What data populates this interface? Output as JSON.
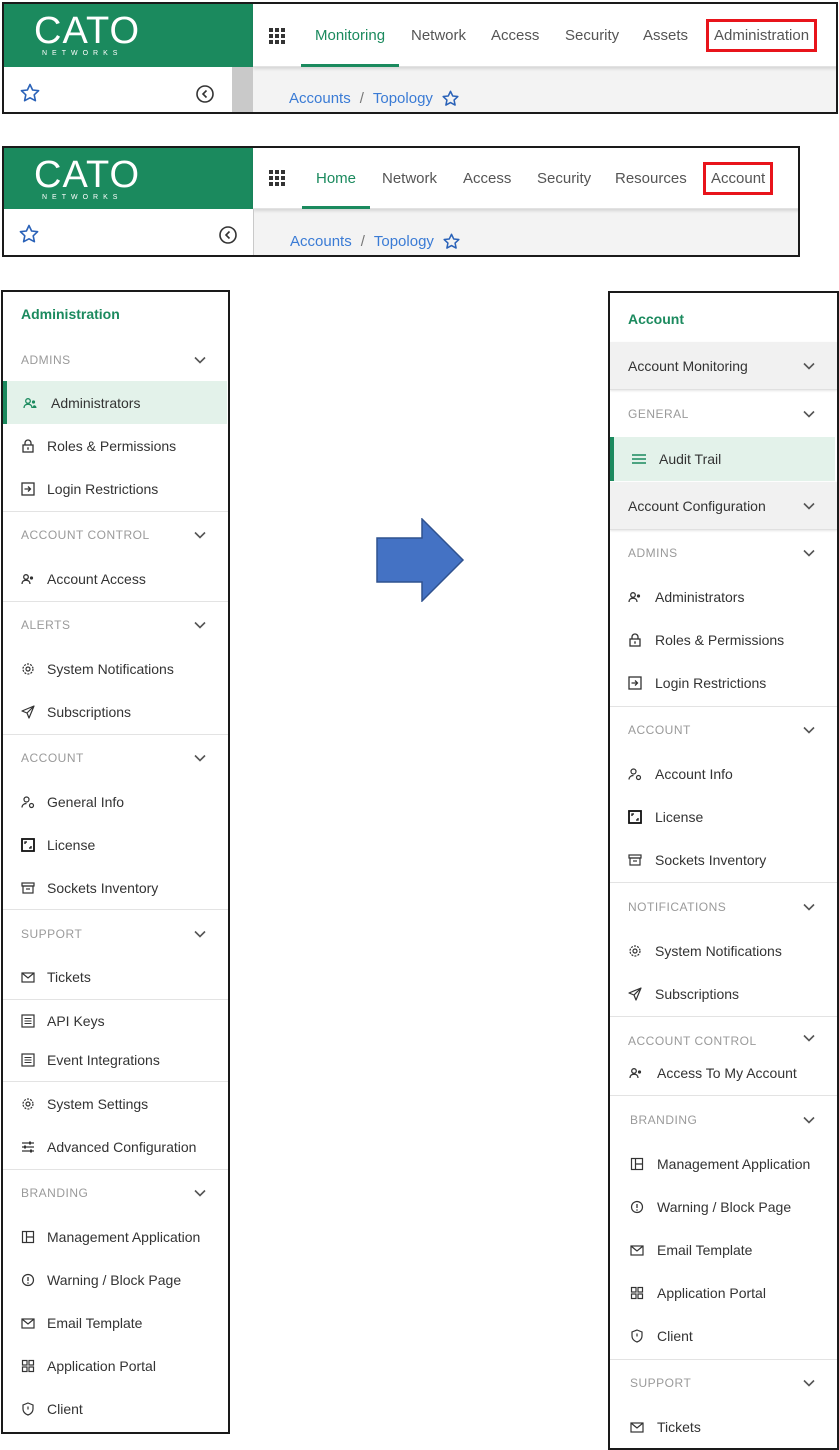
{
  "header_old": {
    "logo": {
      "word": "CATO",
      "sub": "NETWORKS"
    },
    "nav": [
      "Monitoring",
      "Network",
      "Access",
      "Security",
      "Assets",
      "Administration"
    ],
    "active": "Monitoring",
    "highlighted": "Administration",
    "breadcrumb": [
      "Accounts",
      "Topology"
    ]
  },
  "header_new": {
    "logo": {
      "word": "CATO",
      "sub": "NETWORKS"
    },
    "nav": [
      "Home",
      "Network",
      "Access",
      "Security",
      "Resources",
      "Account"
    ],
    "active": "Home",
    "highlighted": "Account",
    "breadcrumb": [
      "Accounts",
      "Topology"
    ]
  },
  "old_sidebar": {
    "title": "Administration",
    "sections": [
      {
        "head": "ADMINS",
        "items": [
          "Administrators",
          "Roles & Permissions",
          "Login Restrictions"
        ]
      },
      {
        "head": "ACCOUNT CONTROL",
        "items": [
          "Account Access"
        ]
      },
      {
        "head": "ALERTS",
        "items": [
          "System Notifications",
          "Subscriptions"
        ]
      },
      {
        "head": "ACCOUNT",
        "items": [
          "General Info",
          "License",
          "Sockets Inventory"
        ]
      },
      {
        "head": "SUPPORT",
        "items": [
          "Tickets"
        ]
      },
      {
        "head": "",
        "items": [
          "API Keys",
          "Event Integrations"
        ]
      },
      {
        "head": "",
        "items": [
          "System Settings",
          "Advanced Configuration"
        ]
      },
      {
        "head": "BRANDING",
        "items": [
          "Management Application",
          "Warning / Block Page",
          "Email Template",
          "Application Portal",
          "Client"
        ]
      }
    ],
    "active_item": "Administrators"
  },
  "new_sidebar": {
    "title": "Account",
    "groups": [
      "Account Monitoring",
      "Account Configuration"
    ],
    "sections": [
      {
        "head": "GENERAL",
        "items": [
          "Audit Trail"
        ]
      },
      {
        "head": "ADMINS",
        "items": [
          "Administrators",
          "Roles & Permissions",
          "Login Restrictions"
        ]
      },
      {
        "head": "ACCOUNT",
        "items": [
          "Account Info",
          "License",
          "Sockets Inventory"
        ]
      },
      {
        "head": "NOTIFICATIONS",
        "items": [
          "System Notifications",
          "Subscriptions"
        ]
      },
      {
        "head": "ACCOUNT CONTROL",
        "items": [
          "Access To My Account"
        ]
      },
      {
        "head": "BRANDING",
        "items": [
          "Management Application",
          "Warning / Block Page",
          "Email Template",
          "Application Portal",
          "Client"
        ]
      },
      {
        "head": "SUPPORT",
        "items": [
          "Tickets"
        ]
      }
    ],
    "active_item": "Audit Trail"
  },
  "colors": {
    "brand": "#1b8a5e",
    "highlight": "#e8141b",
    "arrow": "#4472c4",
    "link": "#3a7bd5"
  }
}
